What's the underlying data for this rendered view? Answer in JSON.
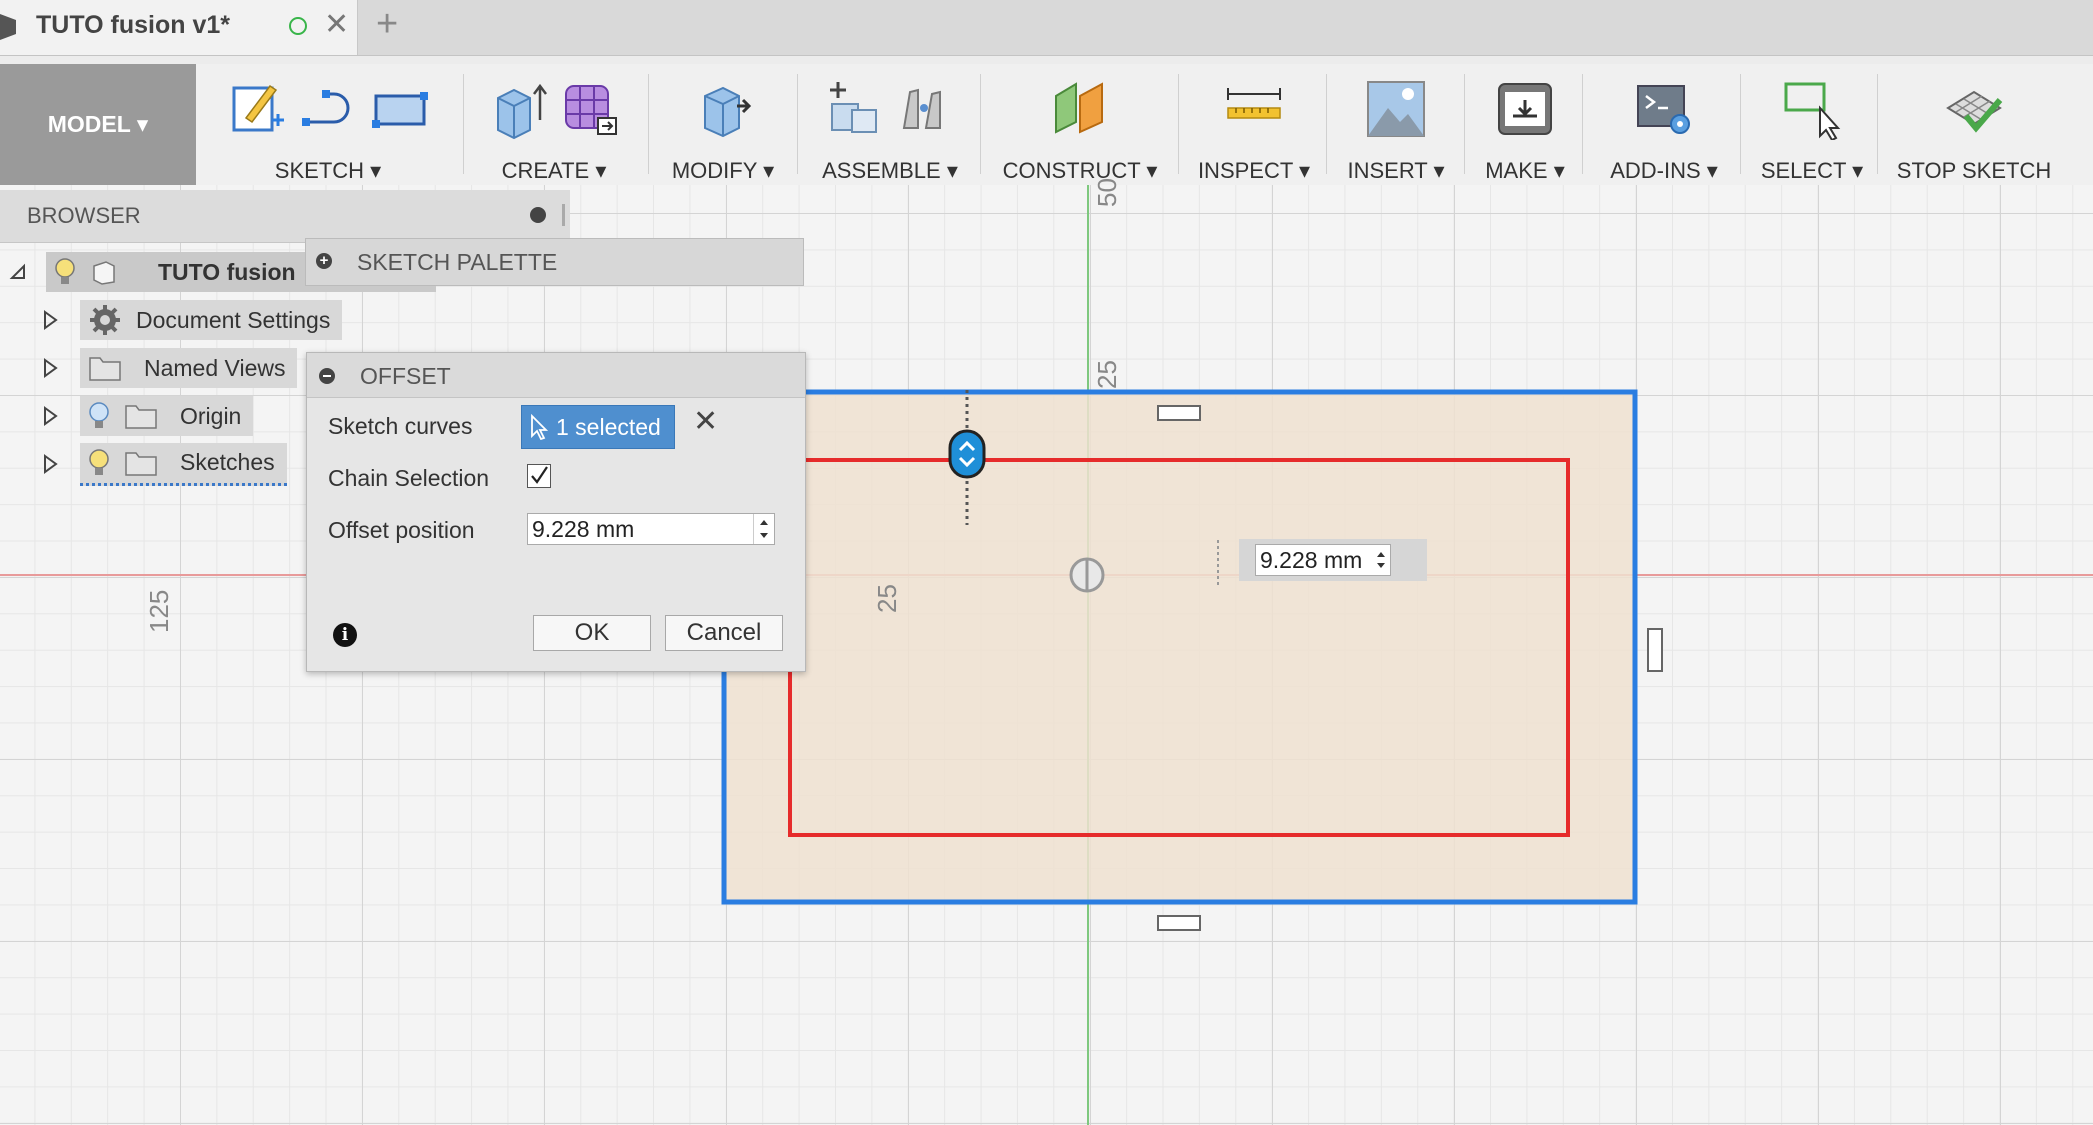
{
  "tab": {
    "title": "TUTO fusion v1*",
    "new_tab": "+"
  },
  "toolbar": {
    "workspace": "MODEL ▾",
    "groups": {
      "sketch": "SKETCH ▾",
      "create": "CREATE ▾",
      "modify": "MODIFY ▾",
      "assemble": "ASSEMBLE ▾",
      "construct": "CONSTRUCT ▾",
      "inspect": "INSPECT ▾",
      "insert": "INSERT ▾",
      "make": "MAKE ▾",
      "addins": "ADD-INS ▾",
      "select": "SELECT ▾",
      "stop_sketch": "STOP SKETCH"
    }
  },
  "browser": {
    "title": "BROWSER",
    "root": "TUTO fusion",
    "items": [
      {
        "label": "Document Settings"
      },
      {
        "label": "Named Views"
      },
      {
        "label": "Origin"
      },
      {
        "label": "Sketches"
      }
    ]
  },
  "sketch_palette": {
    "title": "SKETCH PALETTE"
  },
  "offset_dialog": {
    "title": "OFFSET",
    "sketch_curves_label": "Sketch curves",
    "selection": "1 selected",
    "chain_selection_label": "Chain Selection",
    "chain_selection_checked": true,
    "offset_position_label": "Offset position",
    "offset_value": "9.228 mm",
    "ok": "OK",
    "cancel": "Cancel"
  },
  "canvas": {
    "offset_input_value": "9.228 mm",
    "ruler_labels": {
      "top_50": "50",
      "top_25": "25",
      "left_125": "125",
      "mid_25": "25"
    }
  },
  "colors": {
    "blue_profile": "#2a7de1",
    "red_offset": "#e62b2b",
    "profile_fill": "#efe0d0",
    "green_axis": "#7ec87e",
    "red_axis": "#e89a9a"
  }
}
